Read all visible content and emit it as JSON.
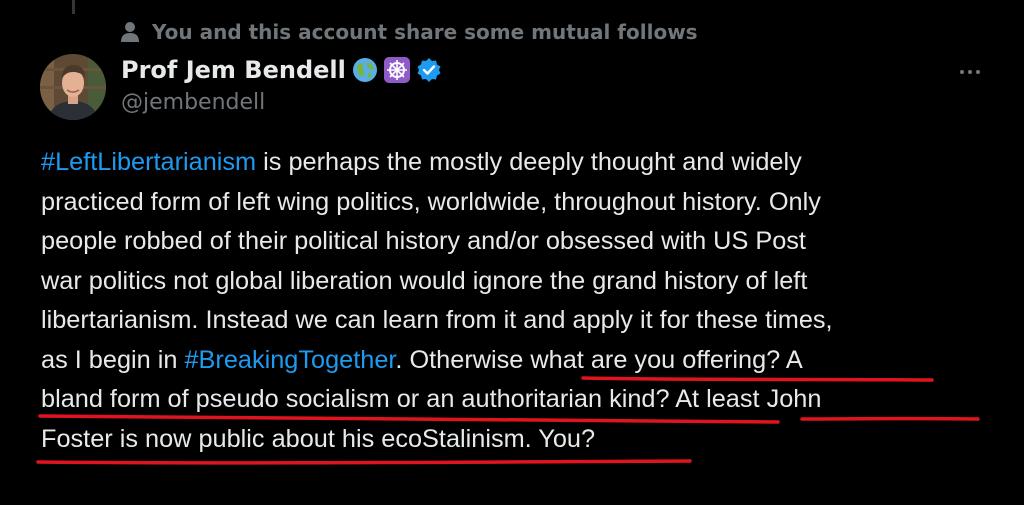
{
  "social_context": {
    "icon": "person-icon",
    "text": "You and this account share some mutual follows"
  },
  "author": {
    "name": "Prof Jem Bendell",
    "handle": "@jembendell",
    "badges": [
      "globe-emoji-icon",
      "dharma-wheel-emoji-icon",
      "verified-badge-icon"
    ]
  },
  "more_icon": "more-options-icon",
  "tweet": {
    "lines": [
      [
        {
          "type": "hashtag",
          "text": "#LeftLibertarianism"
        },
        {
          "type": "text",
          "text": " is perhaps the mostly deeply thought and widely"
        }
      ],
      [
        {
          "type": "text",
          "text": "practiced form of left wing politics, worldwide, throughout history. Only"
        }
      ],
      [
        {
          "type": "text",
          "text": "people robbed of their political history and/or obsessed with US Post"
        }
      ],
      [
        {
          "type": "text",
          "text": "war politics not global liberation would ignore the grand history of left"
        }
      ],
      [
        {
          "type": "text",
          "text": "libertarianism. Instead we can learn from it and apply it for these times,"
        }
      ],
      [
        {
          "type": "text",
          "text": "as I begin in "
        },
        {
          "type": "hashtag",
          "text": "#BreakingTogether"
        },
        {
          "type": "text",
          "text": ". Otherwise what are you offering? A"
        }
      ],
      [
        {
          "type": "text",
          "text": "bland form of pseudo socialism or an authoritarian kind? At least John"
        }
      ],
      [
        {
          "type": "text",
          "text": "Foster is now public about his ecoStalinism. You?"
        }
      ]
    ]
  },
  "colors": {
    "background": "#000000",
    "text": "#e7e9ea",
    "muted": "#71767b",
    "link": "#1d9bf0",
    "annotation": "#e0141e"
  }
}
